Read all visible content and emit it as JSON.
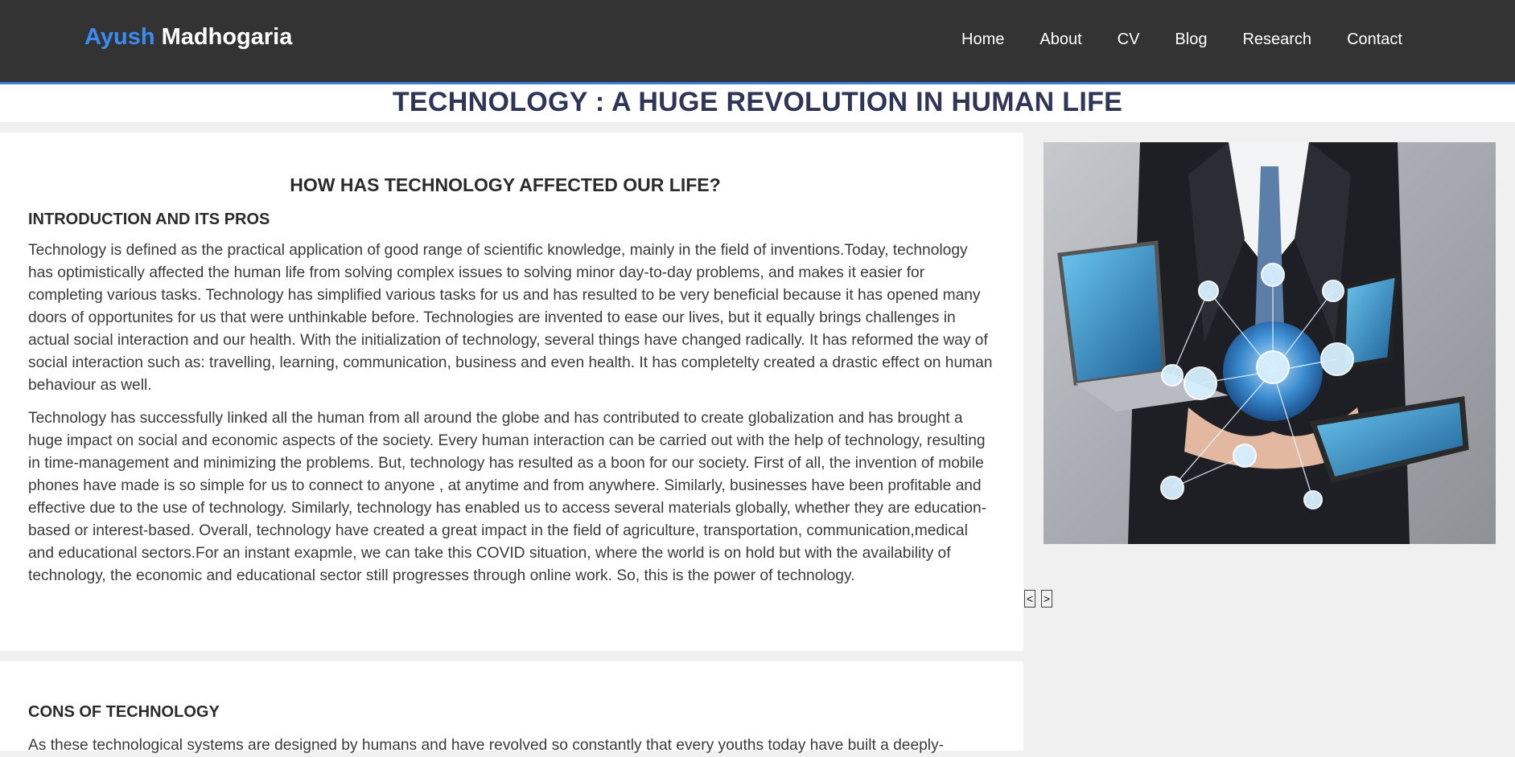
{
  "brand": {
    "first": "Ayush",
    "last": "Madhogaria"
  },
  "nav": [
    "Home",
    "About",
    "CV",
    "Blog",
    "Research",
    "Contact"
  ],
  "page_title": "TECHNOLOGY : A HUGE REVOLUTION IN HUMAN LIFE",
  "article": {
    "heading": "HOW HAS TECHNOLOGY AFFECTED OUR LIFE?",
    "intro_heading": "INTRODUCTION AND ITS PROS",
    "para1": "Technology is defined as the practical application of good range of scientific knowledge, mainly in the field of inventions.Today, technology has optimistically affected the human life from solving complex issues to solving minor day-to-day problems, and makes it easier for completing various tasks. Technology has simplified various tasks for us and has resulted to be very beneficial because it has opened many doors of opportunites for us that were unthinkable before. Technologies are invented to ease our lives, but it equally brings challenges in actual social interaction and our health. With the initialization of technology, several things have changed radically. It has reformed the way of social interaction such as: travelling, learning, communication, business and even health. It has completelty created a drastic effect on human behaviour as well.",
    "para2": "Technology has successfully linked all the human from all around the globe and has contributed to create globalization and has brought a huge impact on social and economic aspects of the society. Every human interaction can be carried out with the help of technology, resulting in time-management and minimizing the problems. But, technology has resulted as a boon for our society. First of all, the invention of mobile phones have made is so simple for us to connect to anyone , at anytime and from anywhere. Similarly, businesses have been profitable and effective due to the use of technology. Similarly, technology has enabled us to access several materials globally, whether they are education-based or interest-based. Overall, technology have created a great impact in the field of agriculture, transportation, communication,medical and educational sectors.For an instant exapmle, we can take this COVID situation, where the world is on hold but with the availability of technology, the economic and educational sector still progresses through online work. So, this is the power of technology.",
    "cons_heading": "CONS OF TECHNOLOGY",
    "cons_para": "As these technological systems are designed by humans and have revolved so constantly that every youths today have built a deeply-"
  },
  "carousel": {
    "prev": "<",
    "next": ">"
  },
  "colors": {
    "nav_bg": "#333333",
    "accent": "#3a7bd5",
    "brand_first": "#3d8bf2",
    "title": "#2e3557"
  }
}
